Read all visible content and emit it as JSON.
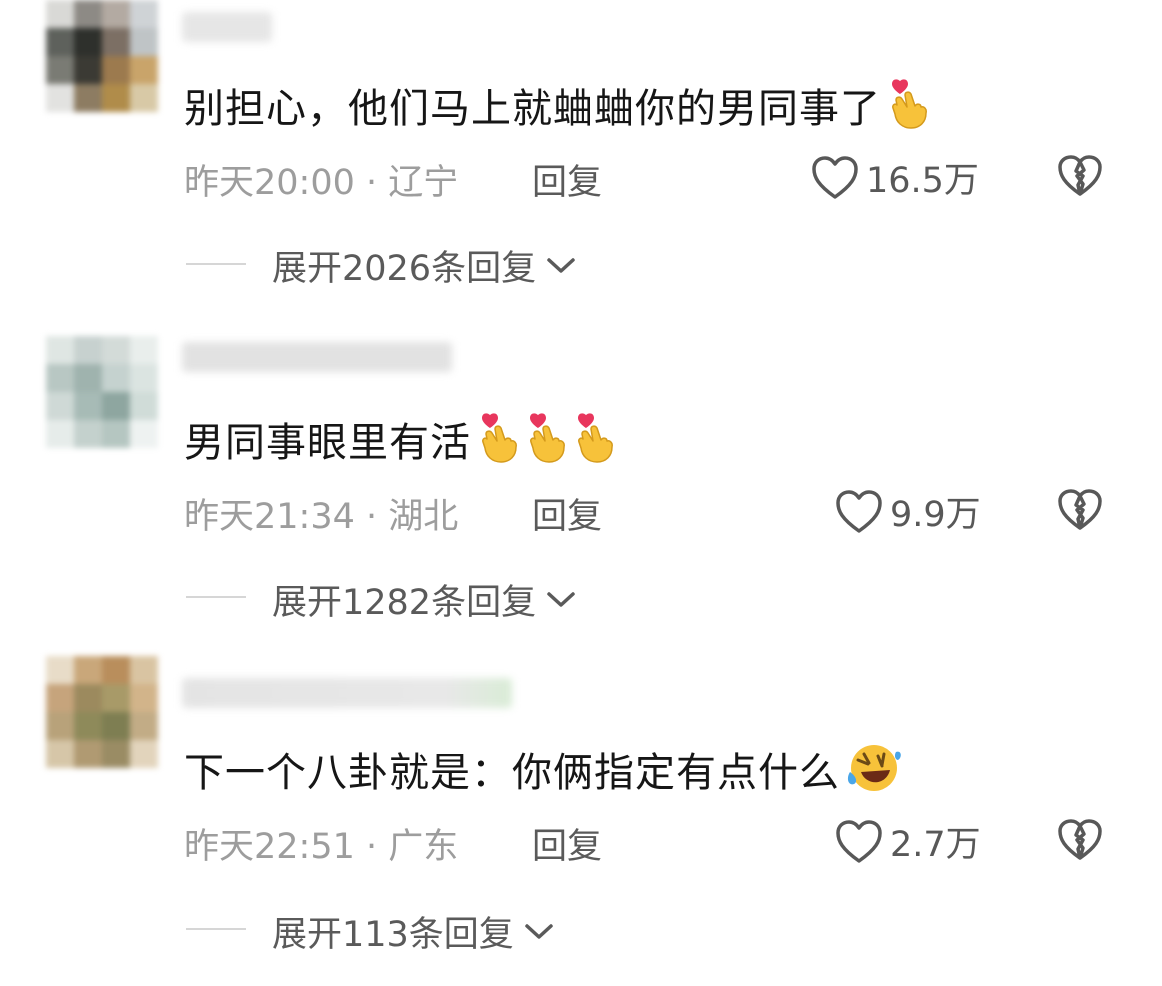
{
  "comments": [
    {
      "text": "别担心，他们马上就蛐蛐你的男同事了",
      "emoji_count": 1,
      "emoji": "finger-heart-emoji",
      "time": "昨天20:00",
      "region": "辽宁",
      "reply": "回复",
      "likes": "16.5万",
      "expand": "展开2026条回复",
      "avatar_colors": [
        "#d9d9d6",
        "#8d8a85",
        "#b3aaa2",
        "#cfd3d6",
        "#5e615c",
        "#2e302c",
        "#7c6f64",
        "#bfc4c6",
        "#7a7b74",
        "#3b3a34",
        "#9c7a4e",
        "#c9a46a",
        "#e2e2e0",
        "#8d7c62",
        "#b08c4a",
        "#d8c9a6"
      ],
      "name_colors": [
        "#e5e5e5",
        "#d7d7d7"
      ]
    },
    {
      "text": "男同事眼里有活",
      "emoji_count": 3,
      "emoji": "finger-heart-emoji",
      "time": "昨天21:34",
      "region": "湖北",
      "reply": "回复",
      "likes": "9.9万",
      "expand": "展开1282条回复",
      "avatar_colors": [
        "#dfe6e3",
        "#c7d1cf",
        "#d3dbd8",
        "#e9eeec",
        "#b8c7c3",
        "#9fb3ae",
        "#c5d2cf",
        "#dbe4e1",
        "#cfd9d6",
        "#a7bbb6",
        "#8ea6a0",
        "#d0dcd8",
        "#e6ecea",
        "#c4d1cd",
        "#b5c6c1",
        "#eef2f1"
      ],
      "name_colors": [
        "#e4e4e4",
        "#d4d4d4"
      ]
    },
    {
      "text": "下一个八卦就是：你俩指定有点什么",
      "emoji_count": 1,
      "emoji": "rolling-laughing-emoji",
      "time": "昨天22:51",
      "region": "广东",
      "reply": "回复",
      "likes": "2.7万",
      "expand": "展开113条回复",
      "avatar_colors": [
        "#e8dcc8",
        "#c9a77a",
        "#b98e5c",
        "#d9c4a2",
        "#c6a47c",
        "#9c8a5e",
        "#a89a68",
        "#d2b48a",
        "#b8a27a",
        "#8e8a5a",
        "#7e7e52",
        "#c2ac86",
        "#d6c6a8",
        "#b09a72",
        "#9a8c64",
        "#e2d4bc"
      ],
      "name_colors": [
        "#e4e4e4",
        "#d9ecd6"
      ]
    }
  ],
  "colors": {
    "text": "#161616",
    "meta": "#9d9d9d",
    "action": "#5a5a5a",
    "heart_emoji": "#e8365d",
    "hand_emoji": "#f7c23a"
  }
}
